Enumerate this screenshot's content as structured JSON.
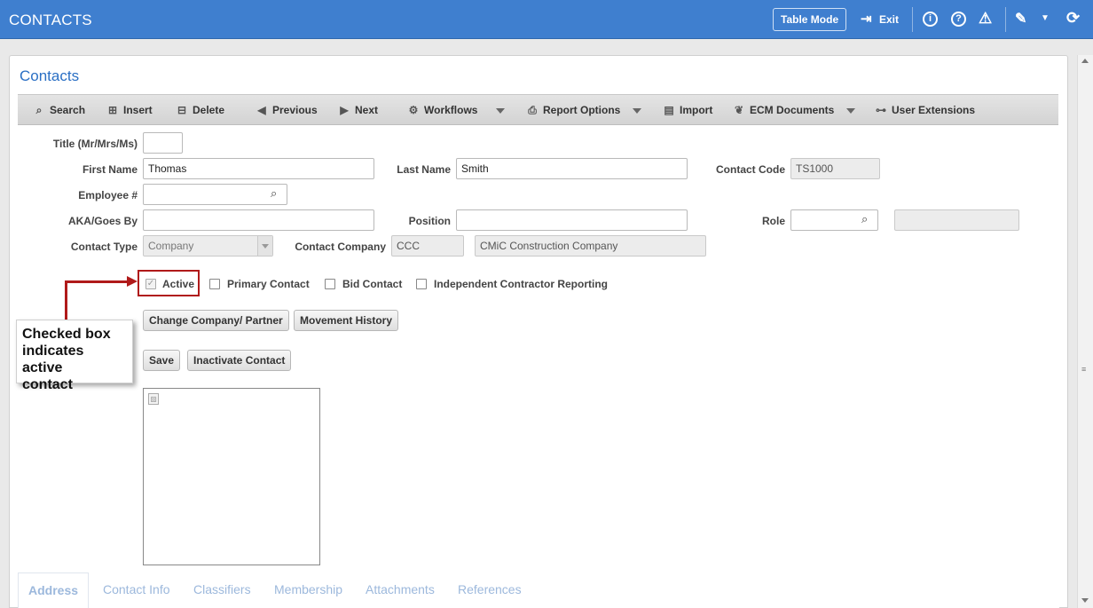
{
  "app": {
    "title": "CONTACTS",
    "table_mode_label": "Table Mode",
    "exit_label": "Exit"
  },
  "page": {
    "title": "Contacts"
  },
  "toolbar": {
    "search": "Search",
    "insert": "Insert",
    "delete": "Delete",
    "previous": "Previous",
    "next": "Next",
    "workflows": "Workflows",
    "report_options": "Report Options",
    "import": "Import",
    "ecm_documents": "ECM Documents",
    "user_extensions": "User Extensions"
  },
  "form": {
    "title_label": "Title (Mr/Mrs/Ms)",
    "title_value": "",
    "first_name_label": "First Name",
    "first_name_value": "Thomas",
    "last_name_label": "Last Name",
    "last_name_value": "Smith",
    "contact_code_label": "Contact Code",
    "contact_code_value": "TS1000",
    "employee_label": "Employee #",
    "employee_value": "",
    "aka_label": "AKA/Goes By",
    "aka_value": "",
    "position_label": "Position",
    "position_value": "",
    "role_label": "Role",
    "role_value": "",
    "role_desc_value": "",
    "contact_type_label": "Contact Type",
    "contact_type_value": "Company",
    "contact_company_label": "Contact Company",
    "contact_company_code": "CCC",
    "contact_company_name": "CMiC Construction Company"
  },
  "checkboxes": {
    "active": "Active",
    "primary_contact": "Primary Contact",
    "bid_contact": "Bid Contact",
    "independent_contractor": "Independent Contractor Reporting"
  },
  "buttons": {
    "change_company": "Change Company/ Partner",
    "movement_history": "Movement History",
    "save": "Save",
    "inactivate_contact": "Inactivate Contact"
  },
  "annotation": {
    "callout_line1": "Checked box",
    "callout_line2": "indicates active",
    "callout_line3": "contact",
    "color": "#b01a1a"
  },
  "tabs": [
    "Address",
    "Contact Info",
    "Classifiers",
    "Membership",
    "Attachments",
    "References"
  ],
  "colors": {
    "header": "#3f7fcf",
    "accent": "#2a6fc4"
  }
}
